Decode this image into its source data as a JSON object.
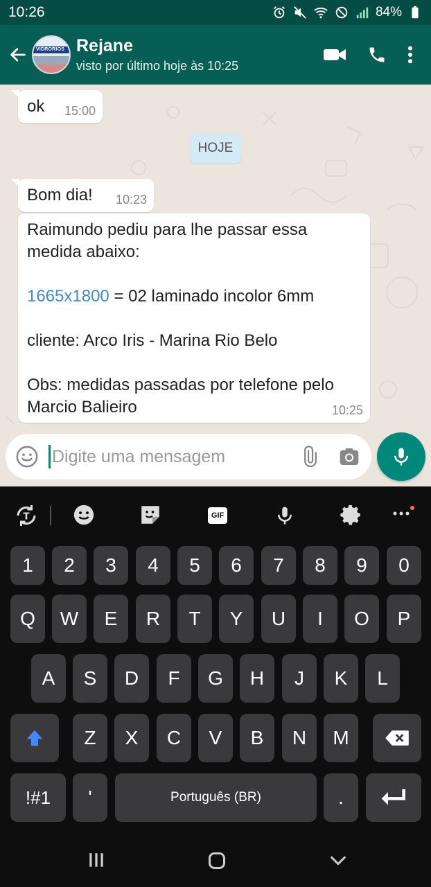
{
  "status_bar": {
    "time": "10:26",
    "battery": "84%"
  },
  "header": {
    "contact_name": "Rejane",
    "last_seen": "visto por último hoje às 10:25",
    "avatar_text": "VIDRORIOS"
  },
  "chat": {
    "messages": [
      {
        "text": "ok",
        "time": "15:00"
      },
      {
        "text": "Bom dia!",
        "time": "10:23"
      },
      {
        "line1": "Raimundo pediu para lhe passar essa",
        "line2": "medida abaixo:",
        "measure_link": "1665x1800",
        "measure_rest": " = 02 laminado incolor 6mm",
        "client": "cliente: Arco Iris - Marina Rio Belo",
        "obs1": "Obs: medidas passadas por telefone pelo",
        "obs2": "Marcio Balieiro",
        "time": "10:25"
      }
    ],
    "date_divider": "HOJE"
  },
  "compose": {
    "placeholder": "Digite uma mensagem"
  },
  "keyboard": {
    "number_row": [
      "1",
      "2",
      "3",
      "4",
      "5",
      "6",
      "7",
      "8",
      "9",
      "0"
    ],
    "row1": [
      "Q",
      "W",
      "E",
      "R",
      "T",
      "Y",
      "U",
      "I",
      "O",
      "P"
    ],
    "row2": [
      "A",
      "S",
      "D",
      "F",
      "G",
      "H",
      "J",
      "K",
      "L"
    ],
    "row3": [
      "Z",
      "X",
      "C",
      "V",
      "B",
      "N",
      "M"
    ],
    "symbols_key": "!#1",
    "apostrophe_key": "'",
    "space_label": "Português (BR)",
    "period_key": ".",
    "gif_label": "GIF"
  },
  "colors": {
    "header": "#075e54",
    "status_bar": "#054d44",
    "accent": "#00897b",
    "chat_bg": "#ece5dd",
    "link": "#3a8ccc"
  }
}
